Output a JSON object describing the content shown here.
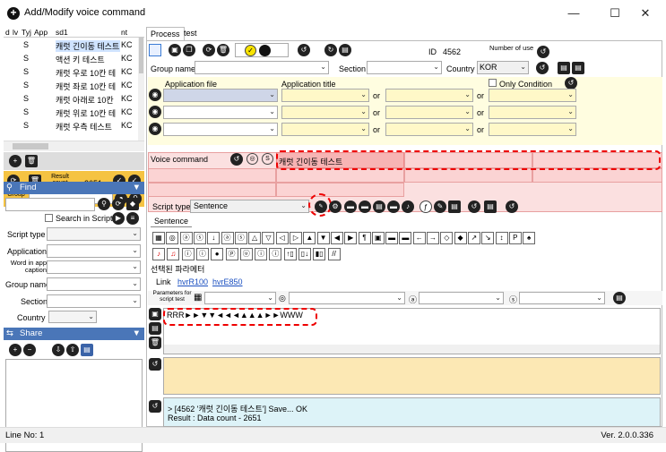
{
  "window": {
    "title": "Add/Modify voice command",
    "icon": "plus-circle-icon",
    "min": "—",
    "max": "☐",
    "close": "✕"
  },
  "grid": {
    "headers": [
      "d",
      "lv",
      "Tyj",
      "App",
      "sd1",
      "nt"
    ],
    "rows": [
      {
        "type": "S",
        "sd1": "캐럿 긴이동 테스트",
        "nt": "KC"
      },
      {
        "type": "S",
        "sd1": "액션 키 테스트",
        "nt": "KC"
      },
      {
        "type": "S",
        "sd1": "캐럿 우로 10칸 테",
        "nt": "KC"
      },
      {
        "type": "S",
        "sd1": "캐럿 좌로 10칸 테",
        "nt": "KC"
      },
      {
        "type": "S",
        "sd1": "캐럿 아래로 10칸",
        "nt": "KC"
      },
      {
        "type": "S",
        "sd1": "캐럿 위로 10칸 테",
        "nt": "KC"
      },
      {
        "type": "S",
        "sd1": "캐럿 우측 테스트",
        "nt": "KC"
      }
    ]
  },
  "result": {
    "label": "Result count",
    "value": "2651",
    "group_section": "Group Section"
  },
  "find": {
    "title": "Find",
    "search_in_script": "Search in Script",
    "fields": [
      "Script type",
      "Application",
      "Word in app caption",
      "Group name",
      "Section",
      "Country"
    ]
  },
  "share": {
    "title": "Share"
  },
  "tabs": [
    "Process",
    "test"
  ],
  "process": {
    "id_label": "ID",
    "id": "4562",
    "number_of_use": "Number of use",
    "group_name": "Group name",
    "section": "Section",
    "country": "Country",
    "country_value": "KOR",
    "application_file": "Application file",
    "application_title": "Application title",
    "only_condition": "Only Condition",
    "or": "or",
    "voice_command": "Voice command",
    "voice_command_value": "캐럿 긴이동 테스트",
    "script_type": "Script type",
    "script_type_value": "Sentence",
    "sentence_tab": "Sentence",
    "selected_param": "선택된 파라메터",
    "link_label": "Link",
    "link1": "hvrR100",
    "link2": "hvrE850",
    "params_label": "Parameters for script test",
    "script_text": "RRR►►▼▼◄◄◄▲▲▲►►WWW",
    "log_line1": "> [4562 '캐럿 긴이동 테스트'] Save... OK",
    "log_line2": "Result : Data count - 2651"
  },
  "status": {
    "line": "Line No: 1",
    "version": "Ver. 2.0.0.336"
  }
}
